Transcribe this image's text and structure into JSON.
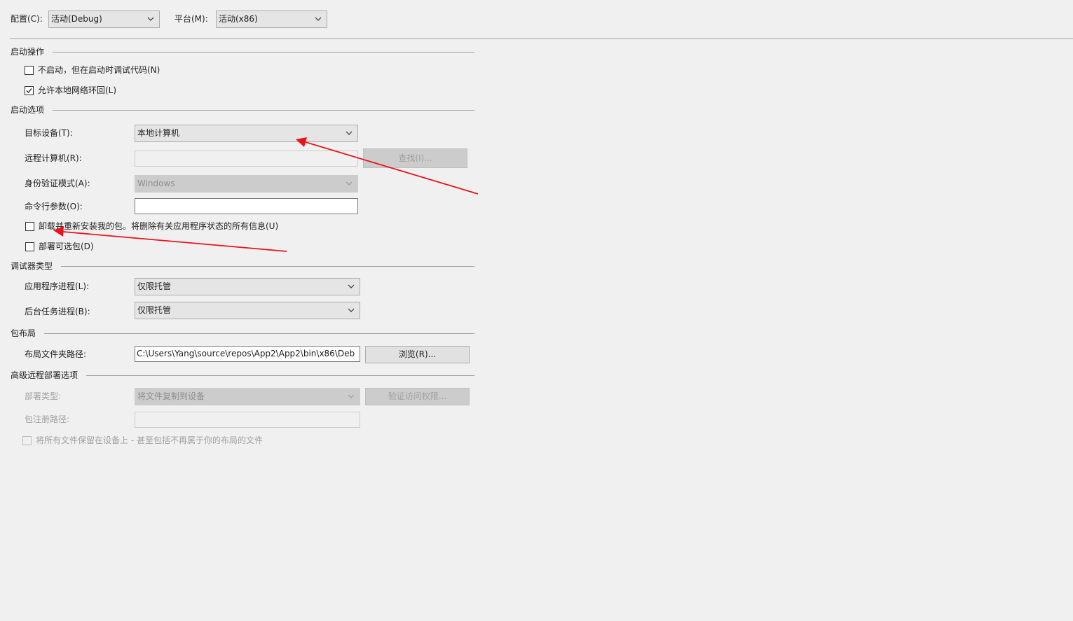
{
  "top": {
    "config_label": "配置(C):",
    "config_value": "活动(Debug)",
    "platform_label": "平台(M):",
    "platform_value": "活动(x86)"
  },
  "launch_actions": {
    "title": "启动操作",
    "no_launch_label": "不启动，但在启动时调试代码(N)",
    "no_launch_checked": false,
    "loopback_label": "允许本地网络环回(L)",
    "loopback_checked": true
  },
  "start_options": {
    "title": "启动选项",
    "target_label": "目标设备(T):",
    "target_value": "本地计算机",
    "remote_label": "远程计算机(R):",
    "remote_value": "",
    "find_button": "查找(I)...",
    "auth_label": "身份验证模式(A):",
    "auth_value": "Windows",
    "cmdline_label": "命令行参数(O):",
    "cmdline_value": "",
    "uninstall_label": "卸载并重新安装我的包。将删除有关应用程序状态的所有信息(U)",
    "uninstall_checked": false,
    "optional_label": "部署可选包(D)",
    "optional_checked": false
  },
  "debugger_type": {
    "title": "调试器类型",
    "app_process_label": "应用程序进程(L):",
    "app_process_value": "仅限托管",
    "bg_task_label": "后台任务进程(B):",
    "bg_task_value": "仅限托管"
  },
  "package_layout": {
    "title": "包布局",
    "folder_label": "布局文件夹路径:",
    "folder_value": "C:\\Users\\Yang\\source\\repos\\App2\\App2\\bin\\x86\\Deb",
    "browse_button": "浏览(R)..."
  },
  "advanced_remote": {
    "title": "高级远程部署选项",
    "deploy_type_label": "部署类型:",
    "deploy_type_value": "将文件复制到设备",
    "verify_button": "验证访问权限...",
    "registration_label": "包注册路径:",
    "registration_value": "",
    "keep_files_label": "将所有文件保留在设备上 - 甚至包括不再属于你的布局的文件",
    "keep_files_checked": false
  },
  "colors": {
    "annotation_arrow": "#e8141c",
    "background": "#f0f0f0"
  }
}
